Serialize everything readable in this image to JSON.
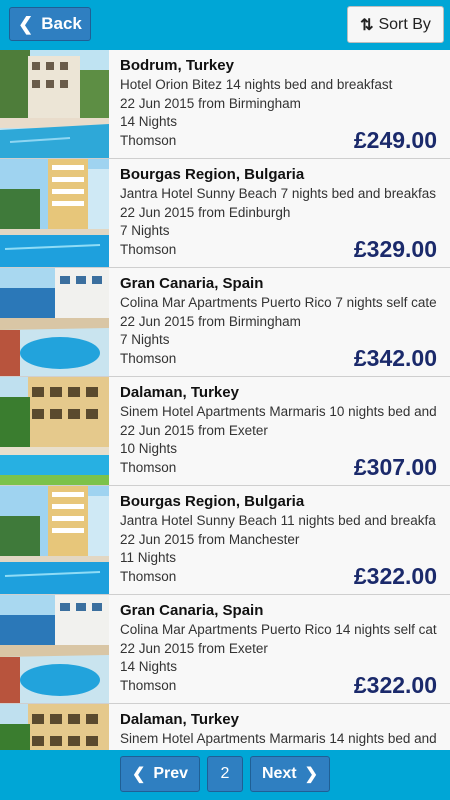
{
  "topbar": {
    "back_label": "Back",
    "sort_label": "Sort By"
  },
  "results": [
    {
      "destination": "Bodrum, Turkey",
      "hotel": "Hotel Orion Bitez 14 nights bed and breakfast",
      "date": "22 Jun 2015 from Birmingham",
      "nights": "14 Nights",
      "operator": "Thomson",
      "price": "£249.00"
    },
    {
      "destination": "Bourgas Region, Bulgaria",
      "hotel": "Jantra Hotel Sunny Beach 7 nights bed and breakfas",
      "date": "22 Jun 2015 from Edinburgh",
      "nights": "7 Nights",
      "operator": "Thomson",
      "price": "£329.00"
    },
    {
      "destination": "Gran Canaria, Spain",
      "hotel": "Colina Mar Apartments Puerto Rico 7 nights self cate",
      "date": "22 Jun 2015 from Birmingham",
      "nights": "7 Nights",
      "operator": "Thomson",
      "price": "£342.00"
    },
    {
      "destination": "Dalaman, Turkey",
      "hotel": "Sinem Hotel Apartments Marmaris 10 nights bed and",
      "date": "22 Jun 2015 from Exeter",
      "nights": "10 Nights",
      "operator": "Thomson",
      "price": "£307.00"
    },
    {
      "destination": "Bourgas Region, Bulgaria",
      "hotel": "Jantra Hotel Sunny Beach 11 nights bed and breakfa",
      "date": "22 Jun 2015 from Manchester",
      "nights": "11 Nights",
      "operator": "Thomson",
      "price": "£322.00"
    },
    {
      "destination": "Gran Canaria, Spain",
      "hotel": "Colina Mar Apartments Puerto Rico 14 nights self cat",
      "date": "22 Jun 2015 from Exeter",
      "nights": "14 Nights",
      "operator": "Thomson",
      "price": "£322.00"
    },
    {
      "destination": "Dalaman, Turkey",
      "hotel": "Sinem Hotel Apartments Marmaris 14 nights bed and",
      "date": "",
      "nights": "",
      "operator": "",
      "price": ""
    }
  ],
  "pagination": {
    "prev_label": "Prev",
    "current_page": "2",
    "next_label": "Next"
  },
  "icons": {
    "back": "chevron-left-icon",
    "sort": "sort-arrows-icon",
    "prev": "chevron-left-icon",
    "next": "chevron-right-icon"
  },
  "colors": {
    "accent": "#00a6d6",
    "button": "#2f7fc1",
    "price": "#1b2a6b"
  }
}
